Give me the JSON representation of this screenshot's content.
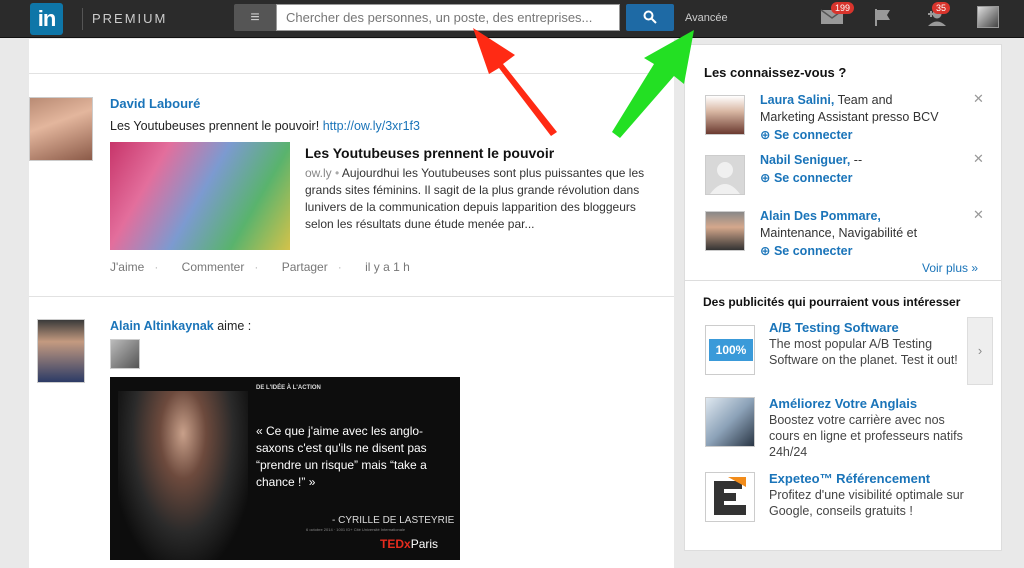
{
  "header": {
    "logo_text": "in",
    "brand": "PREMIUM",
    "menu_icon": "≡",
    "search_placeholder": "Chercher des personnes, un poste, des entreprises...",
    "search_icon": "🔍",
    "advanced_label": "Avancée",
    "messages_badge": "199",
    "notifications_badge": "35"
  },
  "feed": {
    "post1": {
      "author": "David Labouré",
      "text": "Les Youtubeuses prennent le pouvoir!",
      "link": "http://ow.ly/3xr1f3",
      "article_title": "Les Youtubeuses prennent le pouvoir",
      "article_source": "ow.ly",
      "article_body": "Aujourdhui les Youtubeuses sont plus puissantes que les grands sites féminins. Il sagit de la plus grande révolution dans lunivers de la communication depuis lapparition des bloggeurs selon les résultats dune étude menée par...",
      "actions": [
        "J'aime",
        "Commenter",
        "Partager"
      ],
      "time": "il y a 1 h"
    },
    "post2": {
      "author": "Alain Altinkaynak",
      "verb": "aime :",
      "quote_header": "DE L'IDÉE  À L'ACTION",
      "quote": "« Ce que j'aime avec les anglo-saxons c'est qu'ils ne disent pas “prendre un risque” mais “take a chance !” »",
      "quote_author": "- CYRILLE DE LASTEYRIE",
      "quote_small": "6 octobre 2014 · 1001 ID+ Cité Université Internationale",
      "tedx": "TEDx",
      "tedx_city": "Paris"
    }
  },
  "pymk": {
    "title": "Les connaissez-vous ?",
    "items": [
      {
        "name": "Laura Salini,",
        "line1": " Team and",
        "line2": "Marketing Assistant presso BCV",
        "connect": "Se connecter"
      },
      {
        "name": "Nabil Seniguer,",
        "line1": " --",
        "line2": "",
        "connect": "Se connecter"
      },
      {
        "name": "Alain Des Pommare,",
        "line1": "",
        "line2": "Maintenance, Navigabilité et",
        "connect": "Se connecter"
      }
    ],
    "see_more": "Voir plus »"
  },
  "ads": {
    "title": "Des publicités qui pourraient vous intéresser",
    "items": [
      {
        "title": "A/B Testing Software",
        "desc": "The most popular A/B Testing Software on the planet. Test it out!",
        "badge": "100%"
      },
      {
        "title": "Améliorez Votre Anglais",
        "desc": "Boostez votre carrière avec nos cours en ligne et professeurs natifs 24h/24"
      },
      {
        "title": "Expeteo™ Référencement",
        "desc": "Profitez d'une visibilité optimale sur Google, conseils gratuits !"
      }
    ],
    "next": "›"
  }
}
